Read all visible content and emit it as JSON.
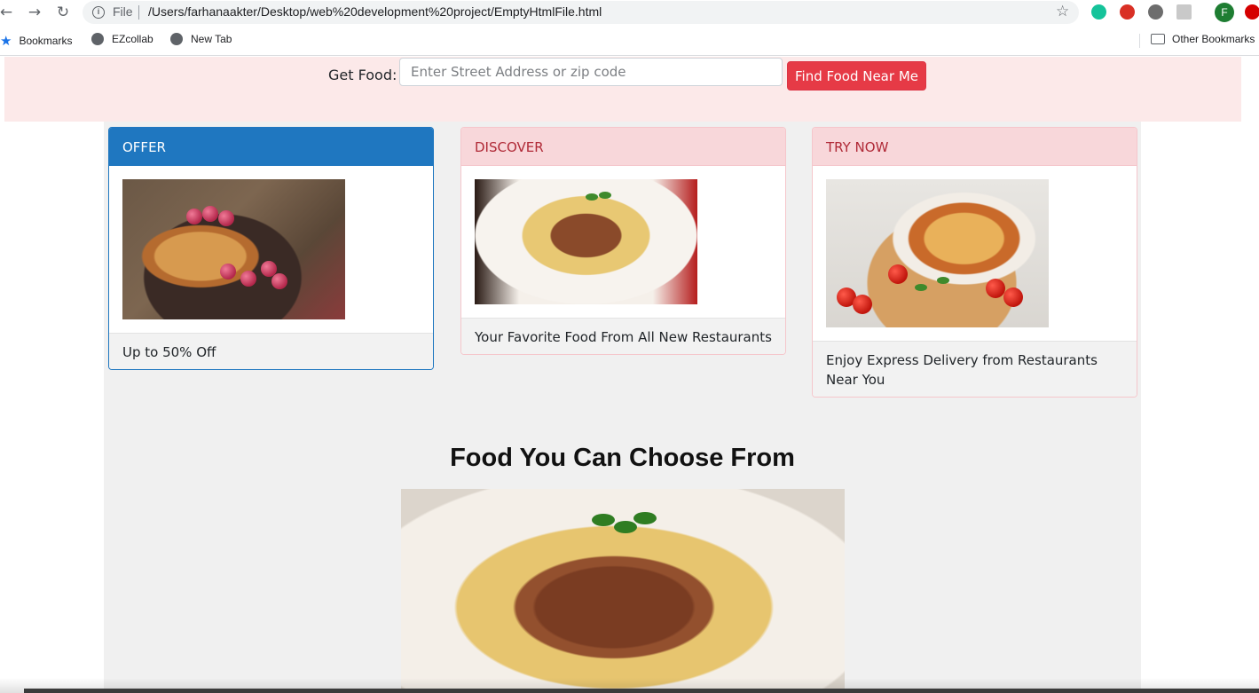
{
  "browser": {
    "file_label": "File",
    "url": "/Users/farhanaakter/Desktop/web%20development%20project/EmptyHtmlFile.html",
    "profile_initial": "F",
    "bookmarks": [
      "Bookmarks",
      "EZcollab",
      "New Tab"
    ],
    "other_bookmarks": "Other Bookmarks"
  },
  "search": {
    "label": "Get Food:",
    "placeholder": "Enter Street Address or zip code",
    "button": "Find Food Near Me"
  },
  "cards": [
    {
      "header": "OFFER",
      "footer": "Up to 50% Off",
      "image": "pancakes-with-raspberries"
    },
    {
      "header": "DISCOVER",
      "footer": "Your Favorite Food From All New Restaurants",
      "image": "spaghetti-bolognese"
    },
    {
      "header": "TRY NOW",
      "footer": "Enjoy Express Delivery from Restaurants Near You",
      "image": "pizza-with-tomatoes"
    }
  ],
  "section": {
    "title": "Food You Can Choose From",
    "image": "spaghetti-bolognese"
  },
  "colors": {
    "primary": "#1f77c0",
    "danger": "#e63a46",
    "banner": "#fce9e9",
    "card_header_pink": "#f8d7da"
  }
}
